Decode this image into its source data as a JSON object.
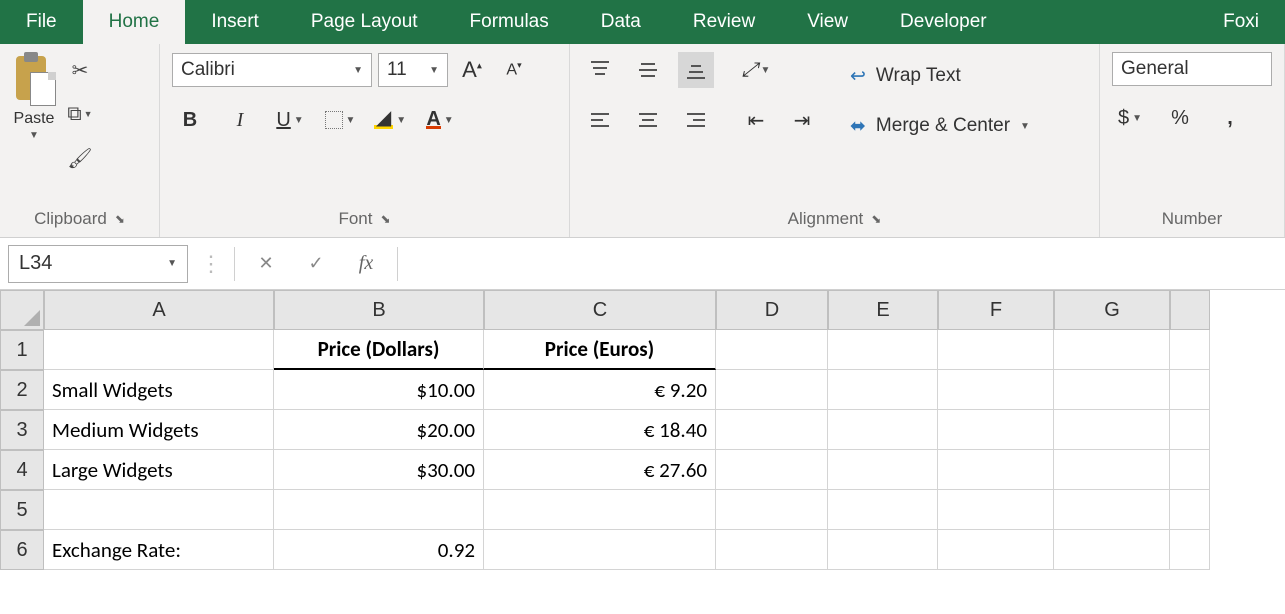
{
  "tabs": [
    "File",
    "Home",
    "Insert",
    "Page Layout",
    "Formulas",
    "Data",
    "Review",
    "View",
    "Developer",
    "Foxi"
  ],
  "active_tab": "Home",
  "ribbon": {
    "clipboard": {
      "paste": "Paste",
      "label": "Clipboard"
    },
    "font": {
      "name": "Calibri",
      "size": "11",
      "bold": "B",
      "italic": "I",
      "underline": "U",
      "label": "Font"
    },
    "alignment": {
      "wrap": "Wrap Text",
      "merge": "Merge & Center",
      "label": "Alignment"
    },
    "number": {
      "format": "General",
      "currency": "$",
      "percent": "%",
      "comma": ",",
      "label": "Number"
    }
  },
  "formula_bar": {
    "name_box": "L34",
    "fx": "fx",
    "formula": ""
  },
  "columns": [
    "A",
    "B",
    "C",
    "D",
    "E",
    "F",
    "G"
  ],
  "rows": [
    "1",
    "2",
    "3",
    "4",
    "5",
    "6"
  ],
  "sheet": {
    "B1": "Price (Dollars)",
    "C1": "Price (Euros)",
    "A2": "Small Widgets",
    "B2": "$10.00",
    "C2": "€ 9.20",
    "A3": "Medium Widgets",
    "B3": "$20.00",
    "C3": "€ 18.40",
    "A4": "Large Widgets",
    "B4": "$30.00",
    "C4": "€ 27.60",
    "A6": "Exchange Rate:",
    "B6": "0.92"
  }
}
